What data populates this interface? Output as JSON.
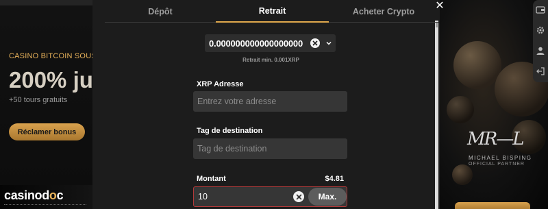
{
  "background": {
    "promo_eyebrow": "CASINO BITCOIN SOUS",
    "promo_headline": "200% ju",
    "promo_sub": "+50 tours gratuits",
    "claim_button": "Réclamer bonus",
    "logo_text_a": "casinod",
    "logo_text_b": "o",
    "logo_text_c": "c",
    "partner_signature": "MR—L",
    "partner_name": "MICHAEL BISPING",
    "partner_role": "OFFICIAL PARTNER"
  },
  "modal": {
    "tabs": [
      {
        "label": "Dépôt",
        "active": false
      },
      {
        "label": "Retrait",
        "active": true
      },
      {
        "label": "Acheter Crypto",
        "active": false
      }
    ],
    "amount_display": "0.000000000000000000",
    "min_withdrawal": "Retrait min. 0.001XRP",
    "address": {
      "label": "XRP Adresse",
      "placeholder": "Entrez votre adresse",
      "value": ""
    },
    "tag": {
      "label": "Tag de destination",
      "placeholder": "Tag de destination",
      "value": ""
    },
    "amount": {
      "label": "Montant",
      "balance": "$4.81",
      "value": "10",
      "max_label": "Max."
    }
  },
  "colors": {
    "accent_gold": "#e0a94d",
    "error_border": "#b33a3a",
    "modal_bg": "#1c1c1c"
  },
  "icons": {
    "close": "close-icon",
    "clear": "clear-circle-icon",
    "chevron": "chevron-down-icon",
    "rail": [
      "wallet-icon",
      "gear-icon",
      "user-icon",
      "logout-icon"
    ]
  }
}
